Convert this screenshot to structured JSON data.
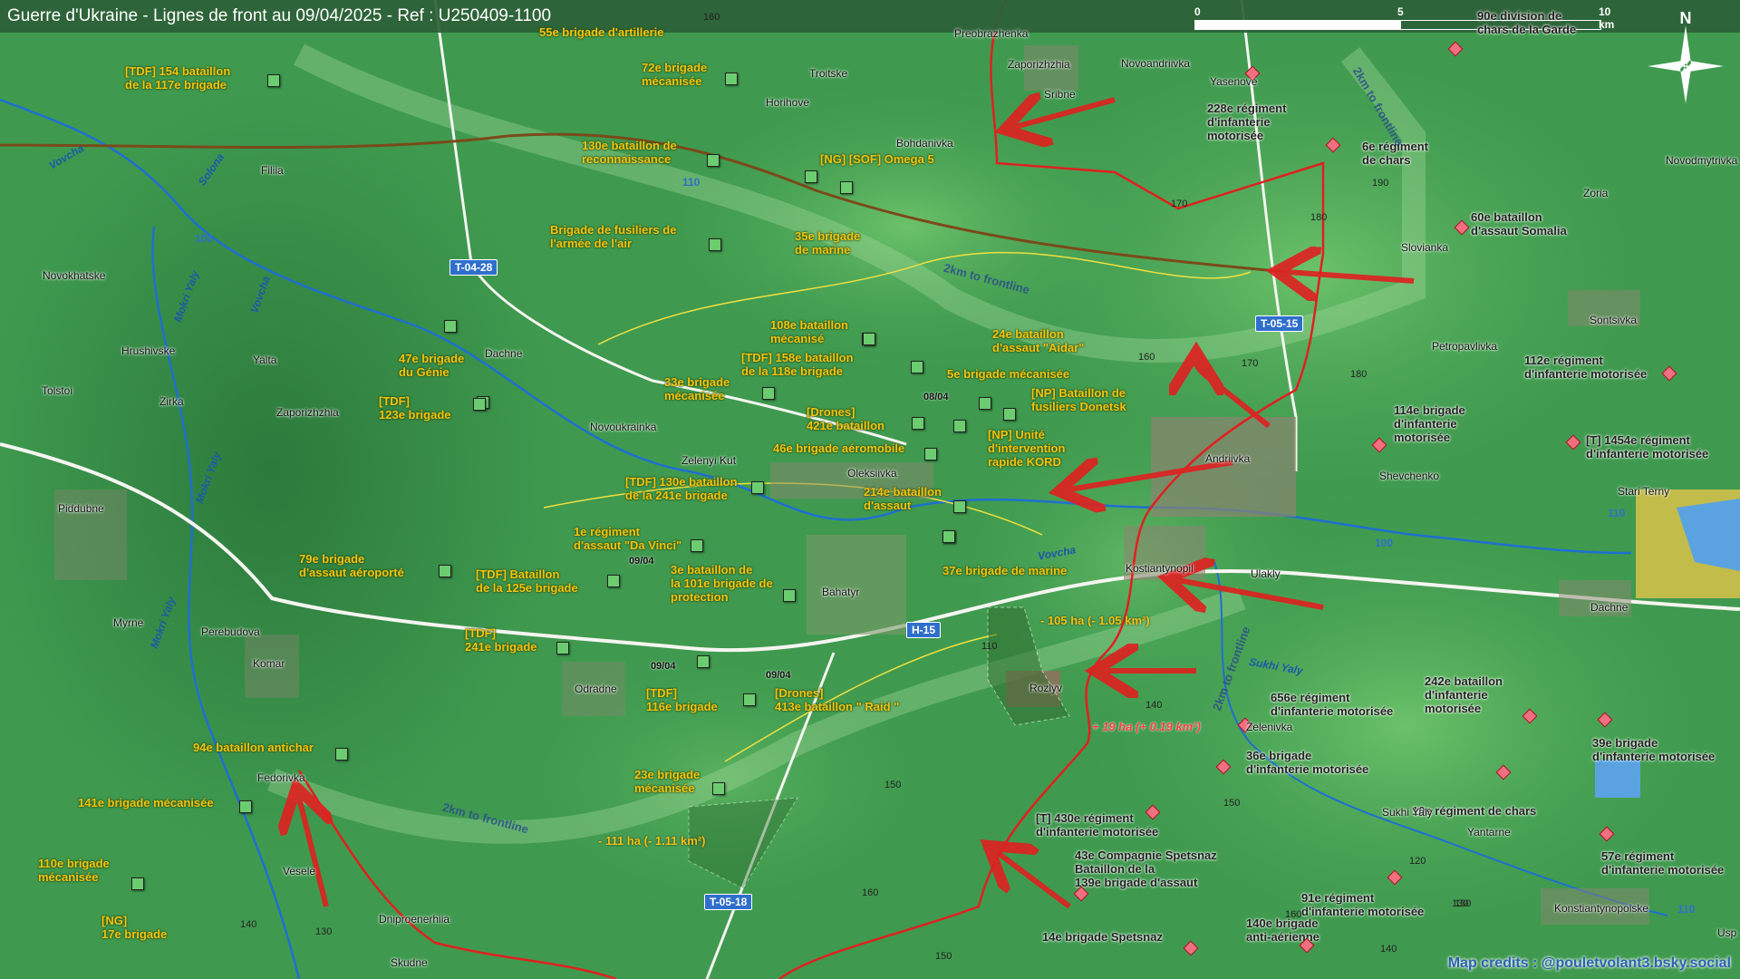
{
  "header": {
    "title": "Guerre d'Ukraine - Lignes de front au 09/04/2025 - Ref : U250409-1100"
  },
  "scale": {
    "ticks": [
      "0",
      "5",
      "10 km"
    ]
  },
  "compass": {
    "north_label": "N"
  },
  "credits": "Map credits : @pouletvolant3.bsky.social",
  "colors": {
    "terrain": "#3f9a4f",
    "russian": "#e02020",
    "ukrainian": "#f1c40f",
    "road": "#f5f5f0",
    "river": "#1f6fd0"
  },
  "ua_units": [
    "55e brigade d'artillerie",
    "[TDF] 154 bataillon\nde la 117e brigade",
    "72e brigade\nmécanisée",
    "130e bataillon de\nreconnaissance",
    "[NG] [SOF] Omega 5",
    "35e brigade\nde marine",
    "Brigade de fusiliers de\nl'armée de l'air",
    "108e bataillon\nmécanisé",
    "24e bataillon\nd'assaut \"Aidar\"",
    "[TDF] 158e bataillon\nde la 118e brigade",
    "5e brigade mécanisée",
    "47e brigade\ndu Génie",
    "33e brigade\nmécanisée",
    "[NP] Bataillon de\nfusiliers Donetsk",
    "[TDF]\n123e brigade",
    "[Drones]\n421e bataillon",
    "[NP] Unité\nd'intervention\nrapide KORD",
    "46e brigade aéromobile",
    "[TDF] 130e bataillon\nde la 241e brigade",
    "214e bataillon\nd'assaut",
    "1e régiment\nd'assaut \"Da Vinci\"",
    "79e brigade\nd'assaut aéroporté",
    "[TDF] Bataillon\nde la 125e brigade",
    "3e bataillon de\nla 101e brigade de\nprotection",
    "37e brigade de marine",
    "[TDF]\n241e brigade",
    "[TDF]\n116e brigade",
    "[Drones]\n413e bataillon \" Raid \"",
    "94e bataillon antichar",
    "23e brigade\nmécanisée",
    "141e brigade mécanisée",
    "110e brigade\nmécanisée",
    "[NG]\n17e brigade"
  ],
  "ru_units": [
    "90e division de\nchars de la Garde",
    "228e régiment\nd'infanterie\nmotorisée",
    "6e régiment\nde chars",
    "60e bataillon\nd'assaut Somalia",
    "112e régiment\nd'infanterie motorisée",
    "114e brigade\nd'infanterie\nmotorisée",
    "[T] 1454e régiment\nd'infanterie motorisée",
    "656e régiment\nd'infanterie motorisée",
    "242e bataillon\nd'infanterie\nmotorisée",
    "36e brigade\nd'infanterie motorisée",
    "39e brigade\nd'infanterie motorisée",
    "10e régiment de chars",
    "[T] 430e régiment\nd'infanterie motorisée",
    "43e Compagnie Spetsnaz\nBataillon de la\n139e brigade d'assaut",
    "57e régiment\nd'infanterie motorisée",
    "91e régiment\nd'infanterie motorisée",
    "140e brigade\nanti-aérienne",
    "14e brigade Spetsnaz"
  ],
  "towns": [
    "Preobrazhenka",
    "Zaporizhzhia",
    "Sribne",
    "Novoandriivka",
    "Yasenove",
    "Troitske",
    "Horihove",
    "Bohdanivka",
    "Filiia",
    "Novodmytrivka",
    "Zoria",
    "Slovianka",
    "Novokhatske",
    "Sontsivka",
    "Petropavlivka",
    "Hrushivske",
    "Yalta",
    "Dachne",
    "Tolstoi",
    "Zirka",
    "Zaporizhzhia",
    "Novoukrainka",
    "Zelenyi Kut",
    "Oleksiivka",
    "Andriivka",
    "Shevchenko",
    "Stari Terny",
    "Piddubne",
    "Kostiantynopil",
    "Ulakly",
    "Dachne",
    "Bahatyr",
    "Myrne",
    "Perebudova",
    "Komar",
    "Odradne",
    "Rozlyv",
    "Zelenivka",
    "Fedorivka",
    "Sukhi Yaly",
    "Yantarne",
    "Vesele",
    "Dniproenerhiia",
    "Skudne",
    "Konstiantynopolske",
    "Usp"
  ],
  "rivers": [
    "Vovcha",
    "Solona",
    "Mokri Yaly",
    "Vovcha",
    "Mokri Yaly",
    "Vovcha",
    "Mokri Yaly",
    "Sukhi Yaly"
  ],
  "roads": [
    "T-04-28",
    "T-05-15",
    "H-15",
    "T-05-18",
    "110",
    "100",
    "110",
    "100",
    "110"
  ],
  "altitudes": [
    "160",
    "170",
    "180",
    "190",
    "160",
    "170",
    "180",
    "150",
    "140",
    "150",
    "160",
    "140",
    "130",
    "120",
    "130",
    "160",
    "150",
    "140",
    "110",
    "130"
  ],
  "frontline_labels": [
    "2km to frontline",
    "2km to frontline",
    "2km to frontline",
    "2km to frontline"
  ],
  "dates": [
    "08/04",
    "09/04",
    "09/04",
    "09/04"
  ],
  "areas": {
    "gain": "- 111 ha (- 1.11 km²)",
    "gain2": "- 105 ha (- 1.05 km²)",
    "loss": "+ 19 ha (+ 0.19 km²)"
  }
}
